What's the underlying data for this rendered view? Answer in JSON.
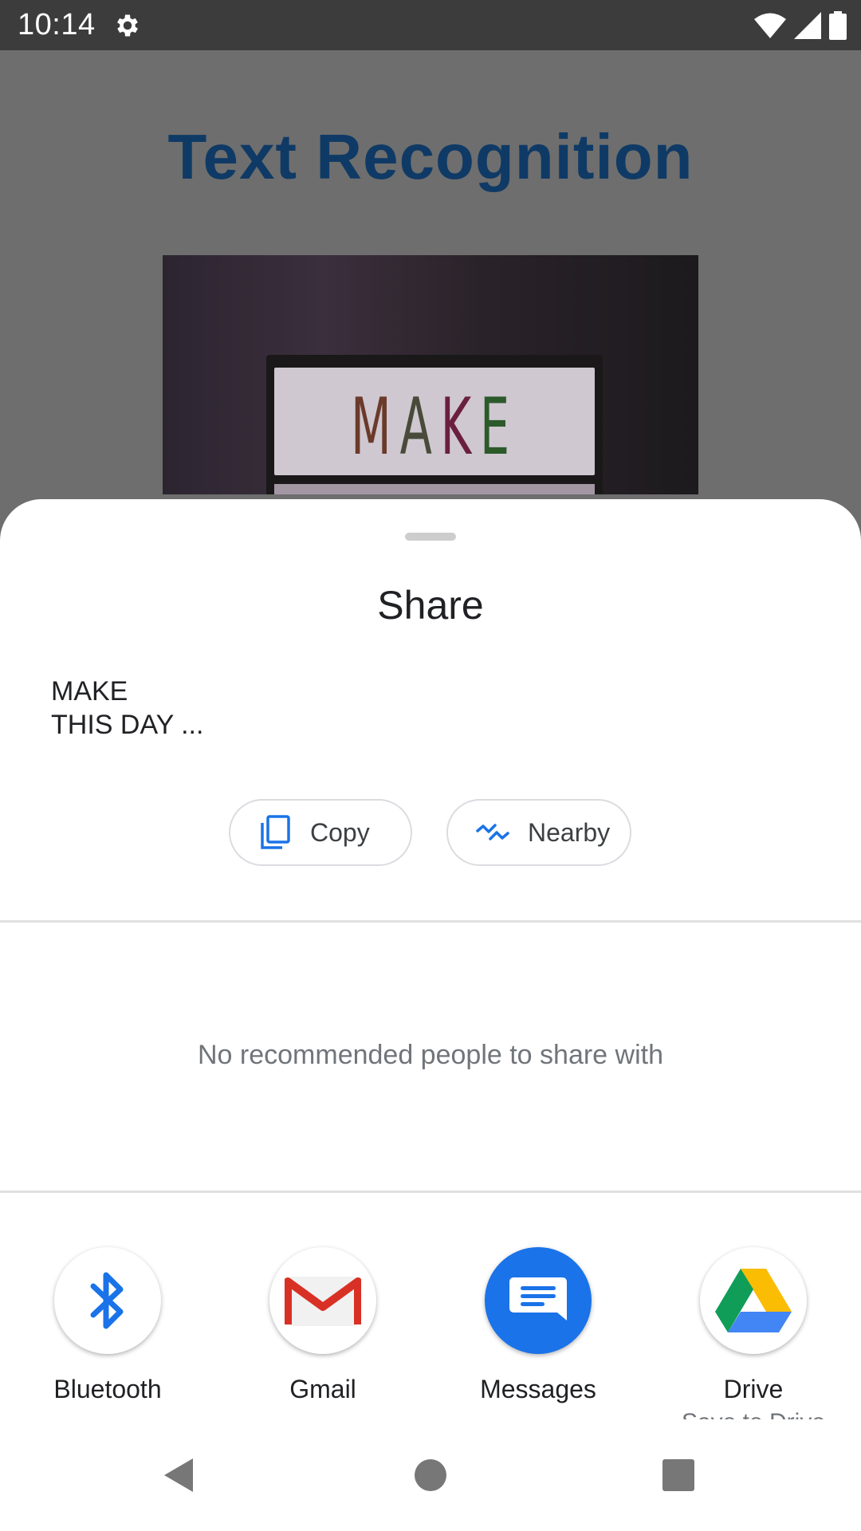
{
  "status_bar": {
    "time": "10:14",
    "icons": [
      "settings-gear-icon",
      "wifi-icon",
      "signal-icon",
      "battery-icon"
    ]
  },
  "app": {
    "title": "Text Recognition",
    "image_text": [
      "M",
      "A",
      "K",
      "E"
    ]
  },
  "share_sheet": {
    "title": "Share",
    "preview_text_line1": "MAKE",
    "preview_text_line2": "THIS DAY ...",
    "actions": [
      {
        "label": "Copy",
        "icon": "copy-icon"
      },
      {
        "label": "Nearby",
        "icon": "nearby-icon"
      }
    ],
    "empty_message": "No recommended people to share with",
    "targets": [
      {
        "label": "Bluetooth",
        "sublabel": "",
        "icon": "bluetooth-icon"
      },
      {
        "label": "Gmail",
        "sublabel": "",
        "icon": "gmail-icon"
      },
      {
        "label": "Messages",
        "sublabel": "",
        "icon": "messages-icon"
      },
      {
        "label": "Drive",
        "sublabel": "Save to Drive",
        "icon": "drive-icon"
      }
    ]
  },
  "nav_bar": {
    "buttons": [
      "back-icon",
      "home-icon",
      "recents-icon"
    ]
  },
  "colors": {
    "accent": "#1a73e8",
    "app_title": "#0f3a66",
    "scrim": "#6e6e6e",
    "status_bar": "#3c3c3c"
  }
}
